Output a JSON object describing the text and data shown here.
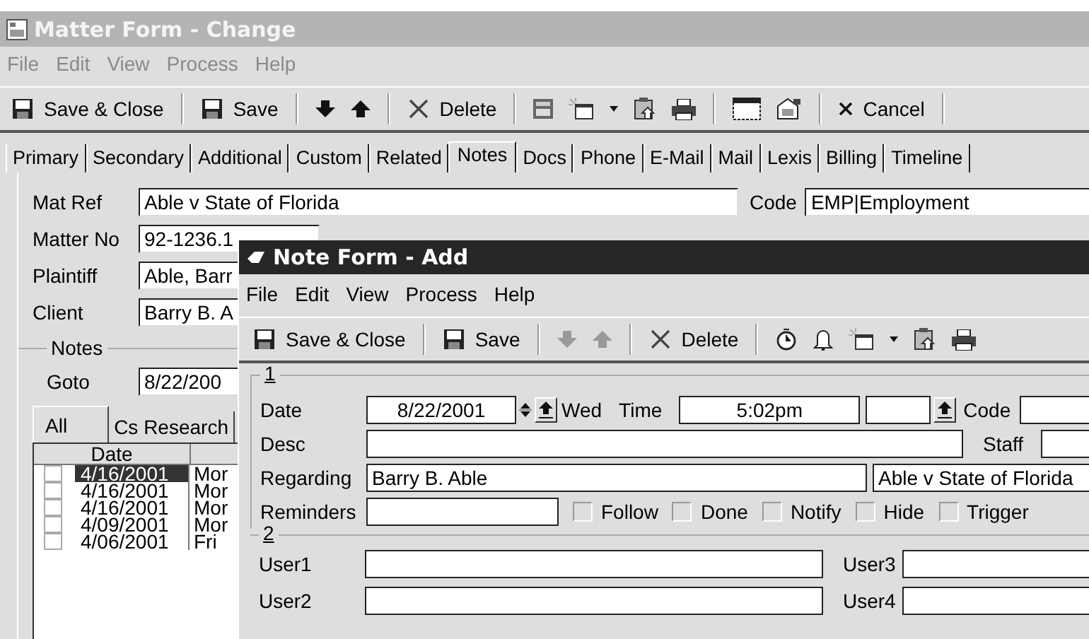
{
  "back_window": {
    "title": "Matter Form - Change",
    "menu": {
      "disabled": true,
      "items": [
        "File",
        "Edit",
        "View",
        "Process",
        "Help"
      ]
    },
    "toolbar": [
      {
        "kind": "floppy",
        "label": "Save & Close"
      },
      {
        "kind": "separator"
      },
      {
        "kind": "floppy",
        "label": "Save"
      },
      {
        "kind": "separator"
      },
      {
        "kind": "down",
        "disabled": false
      },
      {
        "kind": "up",
        "disabled": false
      },
      {
        "kind": "separator"
      },
      {
        "kind": "delete",
        "label": "Delete"
      },
      {
        "kind": "separator"
      },
      {
        "kind": "calc"
      },
      {
        "kind": "new"
      },
      {
        "kind": "dropdown"
      },
      {
        "kind": "clipboard"
      },
      {
        "kind": "printer"
      },
      {
        "kind": "separator"
      },
      {
        "kind": "window"
      },
      {
        "kind": "props"
      },
      {
        "kind": "separator"
      },
      {
        "kind": "cancel",
        "label": "Cancel"
      },
      {
        "kind": "separator"
      }
    ],
    "tabs": [
      {
        "label": "Primary",
        "selected": false
      },
      {
        "label": "Secondary",
        "selected": false
      },
      {
        "label": "Additional",
        "selected": false
      },
      {
        "label": "Custom",
        "selected": false
      },
      {
        "label": "Related",
        "selected": false
      },
      {
        "label": "Notes",
        "selected": true
      },
      {
        "label": "Docs",
        "selected": false
      },
      {
        "label": "Phone",
        "selected": false
      },
      {
        "label": "E-Mail",
        "selected": false
      },
      {
        "label": "Mail",
        "selected": false
      },
      {
        "label": "Lexis",
        "selected": false
      },
      {
        "label": "Billing",
        "selected": false
      },
      {
        "label": "Timeline",
        "selected": false
      }
    ],
    "fields": [
      {
        "label": "Mat Ref",
        "value": "Able v State of Florida"
      },
      {
        "label": "Matter No",
        "value": "92-1236.1"
      },
      {
        "label": "Plaintiff",
        "value": "Able, Barr"
      },
      {
        "label": "Client",
        "value": "Barry B. A"
      }
    ],
    "code": {
      "label": "Code",
      "value": "EMP|Employment"
    },
    "notes": {
      "title": "Notes",
      "goto": {
        "label": "Goto",
        "value": "8/22/200"
      },
      "subtabs": [
        {
          "label": "All",
          "selected": true
        },
        {
          "label": "Cs Research",
          "selected": false
        }
      ],
      "columns": [
        "Date"
      ],
      "rows": [
        {
          "checked": false,
          "date": "4/16/2001",
          "day": "Mor",
          "selected": true
        },
        {
          "checked": false,
          "date": "4/16/2001",
          "day": "Mor",
          "selected": false
        },
        {
          "checked": false,
          "date": "4/16/2001",
          "day": "Mor",
          "selected": false
        },
        {
          "checked": false,
          "date": "4/09/2001",
          "day": "Mor",
          "selected": false
        },
        {
          "checked": false,
          "date": "4/06/2001",
          "day": "Fri",
          "selected": false
        }
      ]
    }
  },
  "front_window": {
    "title": "Note Form - Add",
    "menu": {
      "disabled": false,
      "items": [
        "File",
        "Edit",
        "View",
        "Process",
        "Help"
      ]
    },
    "toolbar": [
      {
        "kind": "floppy",
        "label": "Save & Close"
      },
      {
        "kind": "separator"
      },
      {
        "kind": "floppy",
        "label": "Save"
      },
      {
        "kind": "separator"
      },
      {
        "kind": "down",
        "disabled": true
      },
      {
        "kind": "up",
        "disabled": true
      },
      {
        "kind": "separator"
      },
      {
        "kind": "delete",
        "label": "Delete"
      },
      {
        "kind": "separator"
      },
      {
        "kind": "clock"
      },
      {
        "kind": "bell"
      },
      {
        "kind": "new"
      },
      {
        "kind": "dropdown"
      },
      {
        "kind": "clipboard"
      },
      {
        "kind": "printer"
      }
    ],
    "group_1": {
      "title": "1",
      "date": {
        "label": "Date",
        "value": "8/22/2001",
        "weekday": "Wed"
      },
      "time": {
        "label": "Time",
        "value": "5:02pm"
      },
      "code": {
        "label": "Code"
      },
      "desc": {
        "label": "Desc"
      },
      "staff": {
        "label": "Staff"
      },
      "regarding": {
        "label": "Regarding",
        "value": "Barry B. Able",
        "matter": "Able v State of Florida"
      },
      "reminders": {
        "label": "Reminders",
        "options": [
          {
            "label": "Follow",
            "checked": false
          },
          {
            "label": "Done",
            "checked": false
          },
          {
            "label": "Notify",
            "checked": false
          },
          {
            "label": "Hide",
            "checked": false
          },
          {
            "label": "Trigger",
            "checked": false
          }
        ]
      }
    },
    "group_2": {
      "title": "2",
      "fields": [
        {
          "label": "User1"
        },
        {
          "label": "User3"
        },
        {
          "label": "User2"
        },
        {
          "label": "User4"
        }
      ]
    }
  }
}
